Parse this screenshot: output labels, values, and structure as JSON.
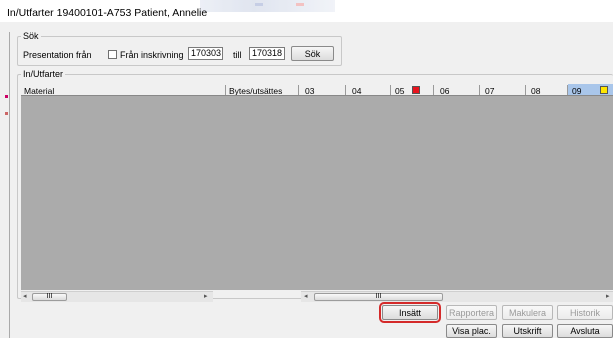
{
  "window": {
    "title": "In/Utfarter 19400101-A753 Patient, Annelie"
  },
  "search": {
    "legend": "Sök",
    "presentation_label": "Presentation från",
    "checkbox_label": "Från inskrivning",
    "from_value": "170303",
    "to_label": "till",
    "to_value": "170318",
    "button": "Sök"
  },
  "grid": {
    "legend": "In/Utfarter",
    "columns": [
      "Material",
      "Bytes/utsättes",
      "03",
      "04",
      "05",
      "06",
      "07",
      "08",
      "09"
    ],
    "flag_colors": {
      "05": "#e8141e",
      "09": "#ffe600"
    },
    "selected_column": "09",
    "scroll_thumb_label": "III"
  },
  "actions": {
    "insatt": "Insätt",
    "rapportera": "Rapportera",
    "makulera": "Makulera",
    "historik": "Historik",
    "visa_plac": "Visa plac.",
    "utskrift": "Utskrift",
    "avsluta": "Avsluta"
  }
}
